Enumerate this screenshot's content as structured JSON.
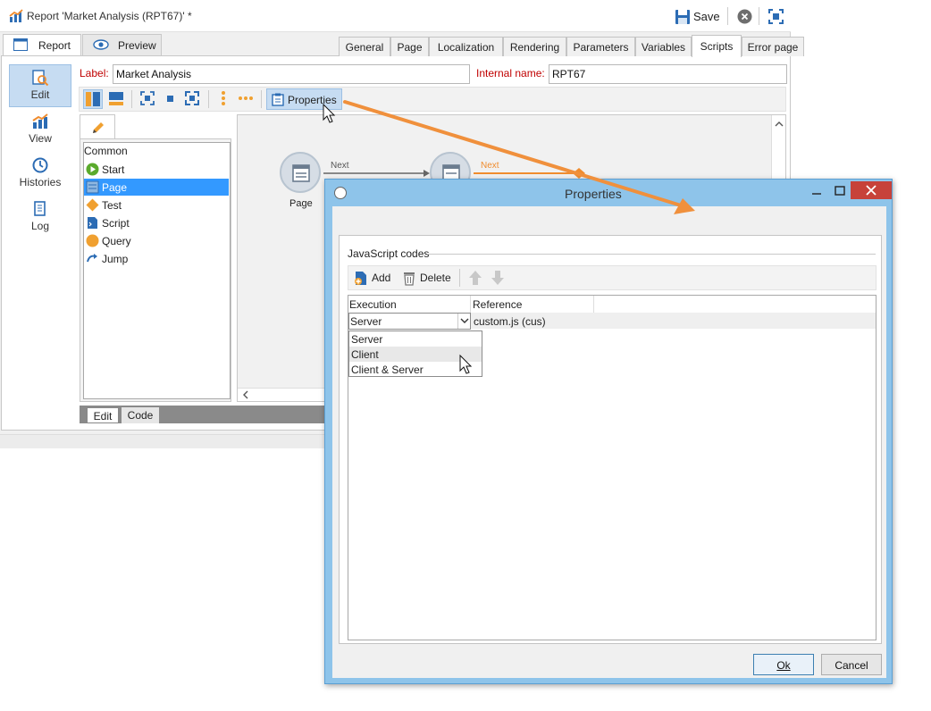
{
  "window": {
    "title": "Report 'Market Analysis (RPT67)' *",
    "save_label": "Save",
    "tabs": [
      {
        "label": "Report"
      },
      {
        "label": "Preview"
      }
    ]
  },
  "nav": {
    "items": [
      {
        "label": "Edit",
        "icon": "edit-search-icon",
        "active": true
      },
      {
        "label": "View",
        "icon": "chart-icon"
      },
      {
        "label": "Histories",
        "icon": "history-icon"
      },
      {
        "label": "Log",
        "icon": "log-icon"
      }
    ]
  },
  "form": {
    "label_caption": "Label:",
    "label_value": "Market Analysis",
    "internal_name_caption": "Internal name:",
    "internal_name_value": "RPT67"
  },
  "editor_toolbar": {
    "properties_label": "Properties"
  },
  "palette": {
    "header": "Common",
    "items": [
      {
        "label": "Start",
        "icon": "start-icon"
      },
      {
        "label": "Page",
        "icon": "page-icon",
        "selected": true
      },
      {
        "label": "Test",
        "icon": "test-icon"
      },
      {
        "label": "Script",
        "icon": "script-icon"
      },
      {
        "label": "Query",
        "icon": "query-icon"
      },
      {
        "label": "Jump",
        "icon": "jump-icon"
      }
    ],
    "bottom_tabs": [
      {
        "label": "Edit",
        "active": true
      },
      {
        "label": "Code"
      }
    ]
  },
  "canvas": {
    "node_label": "Page",
    "transitions": [
      {
        "label": "Next"
      },
      {
        "label": "Next"
      }
    ]
  },
  "dialog": {
    "title": "Properties",
    "tabs": [
      {
        "label": "General"
      },
      {
        "label": "Page"
      },
      {
        "label": "Localization"
      },
      {
        "label": "Rendering"
      },
      {
        "label": "Parameters"
      },
      {
        "label": "Variables"
      },
      {
        "label": "Scripts",
        "active": true
      },
      {
        "label": "Error page"
      }
    ],
    "section_title": "JavaScript codes",
    "toolbar": {
      "add_label": "Add",
      "delete_label": "Delete"
    },
    "grid": {
      "columns": [
        "Execution",
        "Reference"
      ],
      "rows": [
        {
          "execution": "Server",
          "reference": "custom.js (cus)"
        }
      ]
    },
    "execution_options": [
      "Server",
      "Client",
      "Client & Server"
    ],
    "highlighted_option": "Client",
    "ok_label": "Ok",
    "cancel_label": "Cancel"
  },
  "colors": {
    "accent_blue": "#3399ff",
    "selection_blue": "#c6dcf2",
    "arrow_orange": "#f0903c",
    "required_red": "#c00000",
    "dialog_frame": "#8ec4ea",
    "close_red": "#c7423a"
  }
}
